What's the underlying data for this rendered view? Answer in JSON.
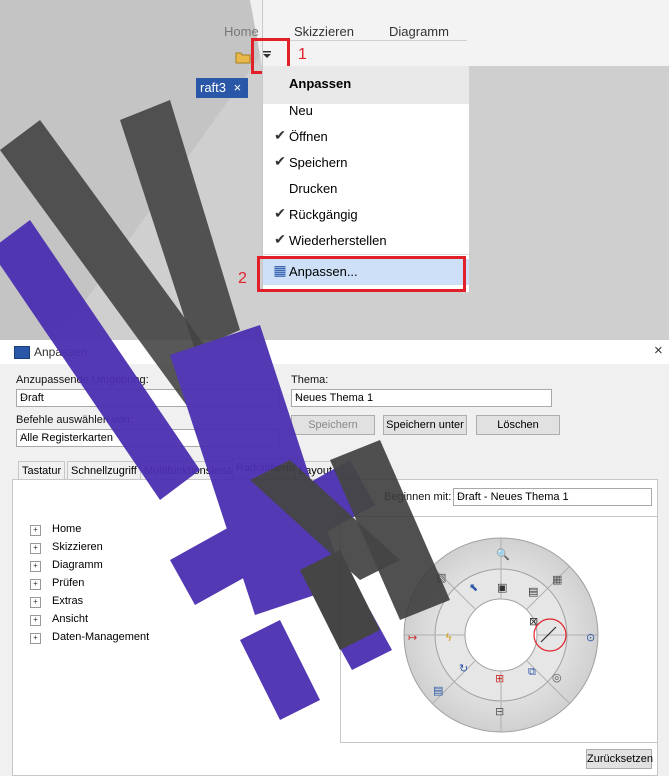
{
  "ribbon": {
    "home_tab": "Home",
    "tabs": [
      "Skizzieren",
      "Diagramm"
    ],
    "doc_tab": "raft3",
    "doc_tab_close": "×"
  },
  "annotations": {
    "step1": "1",
    "step2": "2"
  },
  "menu": {
    "header": "Anpassen",
    "items": [
      {
        "label": "Neu",
        "checked": false
      },
      {
        "label": "Öffnen",
        "checked": true
      },
      {
        "label": "Speichern",
        "checked": true
      },
      {
        "label": "Drucken",
        "checked": false
      },
      {
        "label": "Rückgängig",
        "checked": true
      },
      {
        "label": "Wiederherstellen",
        "checked": true
      }
    ],
    "customize": "Anpassen...",
    "check_glyph": "✔"
  },
  "dialog": {
    "title": "Anpassen",
    "close": "×",
    "env_label": "Anzupassende Umgebung:",
    "env_value": "Draft",
    "theme_label": "Thema:",
    "theme_value": "Neues Thema 1",
    "commands_label": "Befehle auswählen von:",
    "commands_value": "Alle Registerkarten",
    "save_btn": "Speichern",
    "saveas_btn": "Speichern unter",
    "delete_btn": "Löschen",
    "tabs": [
      "Tastatur",
      "Schnellzugriff",
      "Multifunktionsleiste",
      "Radialmenü",
      "Layout"
    ],
    "active_tab": "Radialmenü",
    "begin_label": "Beginnen mit:",
    "begin_value": "Draft - Neues Thema 1",
    "tree": [
      "Home",
      "Skizzieren",
      "Diagramm",
      "Prüfen",
      "Extras",
      "Ansicht",
      "Daten-Management"
    ],
    "reset_btn": "Zurücksetzen"
  },
  "colors": {
    "accent_red": "#e2202a",
    "watermark_purple": "#4b2fb0",
    "watermark_dark": "#3c3c3c",
    "highlight": "#cde0f7"
  }
}
